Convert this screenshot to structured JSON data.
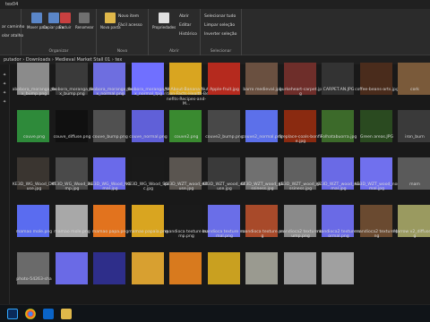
{
  "window": {
    "title": "tex04"
  },
  "ribbon": {
    "left_links": [
      "ar caminho",
      "olar atalho"
    ],
    "organize_label": "Organizar",
    "move_label": "Mover para",
    "copy_label": "Copiar para",
    "delete_label": "Excluir",
    "rename_label": "Renomear",
    "new_folder_label": "Nova pasta",
    "new_item_label": "Novo item",
    "easy_access_label": "Fácil acesso",
    "new_label": "Novo",
    "properties_label": "Propriedades",
    "open_label": "Abrir",
    "edit_label": "Editar",
    "history_label": "Histórico",
    "open_group_label": "Abrir",
    "select_all_label": "Selecionar tudo",
    "select_none_label": "Limpar seleção",
    "invert_label": "Inverter seleção",
    "select_group_label": "Selecionar"
  },
  "address": {
    "crumbs": [
      "putador",
      "Downloads",
      "Medieval Market Stall 01",
      "tex"
    ]
  },
  "files": [
    {
      "name": "abobora_moranga_tex_bump.png",
      "thumb": "#8b8b8b"
    },
    {
      "name": "abobora_moranga_tex_bump.png",
      "thumb": "#3a3a3a"
    },
    {
      "name": "abobora_moranga_tex_normal.png",
      "thumb": "#6e6ee0"
    },
    {
      "name": "abobora_moranga_tex_normal_tpg",
      "thumb": "#7070ff"
    },
    {
      "name": "All-About-Banana-Nutrition-Facts-Health-Benefits-Recipes-and-M...",
      "thumb": "#d9a520"
    },
    {
      "name": "Apple-fruit.jpg",
      "thumb": "#b52a1e"
    },
    {
      "name": "barro medieval.jpg",
      "thumb": "#6a5040"
    },
    {
      "name": "burkeheart-carpet.jpg",
      "thumb": "#6e2e2a"
    },
    {
      "name": "CARPET.AN.JPG",
      "thumb": "#333333"
    },
    {
      "name": "coffee-beans-arts.jpg",
      "thumb": "#4a2c1c"
    },
    {
      "name": "cork",
      "thumb": "#7a5a3a"
    },
    {
      "name": "couve.png",
      "thumb": "#2e8a3a"
    },
    {
      "name": "couve_diffuse.png",
      "thumb": "#101010"
    },
    {
      "name": "couve_bump.png",
      "thumb": "#505050"
    },
    {
      "name": "couve_normal.png",
      "thumb": "#6060d8"
    },
    {
      "name": "couve2.png",
      "thumb": "#3a8a30"
    },
    {
      "name": "couve2_bump.png",
      "thumb": "#484848"
    },
    {
      "name": "couve2_normal.png",
      "thumb": "#5c70ea"
    },
    {
      "name": "fireplace-coals-bonfire.jpg",
      "thumb": "#8a2a10"
    },
    {
      "name": "Folhatabuorra.jpg",
      "thumb": "#3c6a2a"
    },
    {
      "name": "Green areas.JPG",
      "thumb": "#2a4a20"
    },
    {
      "name": "iron_burn",
      "thumb": "#3a3a3a"
    },
    {
      "name": "KE3D_WG_Wood_Diffuse.jpg",
      "thumb": "#3a3530"
    },
    {
      "name": "KE3D_WG_Wood_Bump.jpg",
      "thumb": "#4a4a4a"
    },
    {
      "name": "KE3D_WG_Wood_Normal.jpg",
      "thumb": "#6a6aea"
    },
    {
      "name": "KE3D_WG_Wood_Spec.jpg",
      "thumb": "#1a1a1a"
    },
    {
      "name": "KE3D_WZT_wood_diffuse.jpg",
      "thumb": "#5a5550"
    },
    {
      "name": "KE3D_WZT_wood_diffuse.jpg",
      "thumb": "#3a3a3a"
    },
    {
      "name": "KE3D_WZT_wood_glossiness.jpg",
      "thumb": "#707070"
    },
    {
      "name": "KE3D_WZT_wood_glossiness.jpg",
      "thumb": "#606060"
    },
    {
      "name": "KE3D_WZT_wood_normal.jpg",
      "thumb": "#6a6ae6"
    },
    {
      "name": "KE3D_WZT_wood_normal.jpg",
      "thumb": "#7070ee"
    },
    {
      "name": "mam",
      "thumb": "#5a5a5a"
    },
    {
      "name": "mamao mole.png",
      "thumb": "#5a6cf0"
    },
    {
      "name": "mamao mole.png",
      "thumb": "#a8a8a8"
    },
    {
      "name": "mamao papa.png",
      "thumb": "#e2731e"
    },
    {
      "name": "mamao papaia.png",
      "thumb": "#d9a520"
    },
    {
      "name": "mandioca texture bump.png",
      "thumb": "#1a1a1a"
    },
    {
      "name": "mandioca texture normal.png",
      "thumb": "#6a6ee8"
    },
    {
      "name": "mandioca texture.png",
      "thumb": "#a84a2a"
    },
    {
      "name": "mandioca2 texture bump.png",
      "thumb": "#8a8a8a"
    },
    {
      "name": "mandioca2 texture normal.png",
      "thumb": "#6a6ae6"
    },
    {
      "name": "mandioca2 texture.png",
      "thumb": "#6a4a30"
    },
    {
      "name": "Marrow v2_diffuse.jpg",
      "thumb": "#9a9a60"
    },
    {
      "name": "photo-54263-sha",
      "thumb": "#6a6a6a"
    },
    {
      "name": "",
      "thumb": "#6a6ae6"
    },
    {
      "name": "",
      "thumb": "#2e2e8a"
    },
    {
      "name": "",
      "thumb": "#d8a030"
    },
    {
      "name": "",
      "thumb": "#d87a1e"
    },
    {
      "name": "",
      "thumb": "#c9a020"
    },
    {
      "name": "",
      "thumb": "#9a9a90"
    },
    {
      "name": "",
      "thumb": "#9a9a9a"
    },
    {
      "name": "",
      "thumb": "#a0a0a0"
    }
  ],
  "taskbar": {
    "apps": [
      "photoshop-icon",
      "chrome-icon",
      "vscode-icon",
      "file-explorer-icon"
    ]
  }
}
